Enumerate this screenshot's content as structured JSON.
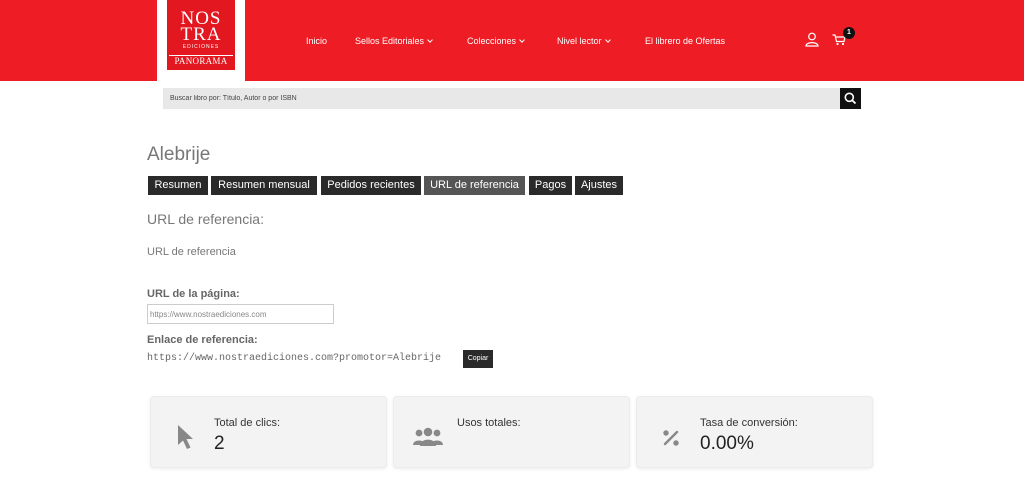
{
  "brand": {
    "line1": "NOS",
    "line2": "TRA",
    "line3": "EDICIONES",
    "line4": "PANORAMA",
    "color": "#ee1c25"
  },
  "nav": {
    "items": [
      {
        "label": "Inicio",
        "has_dropdown": false
      },
      {
        "label": "Sellos Editoriales",
        "has_dropdown": true
      },
      {
        "label": "Colecciones",
        "has_dropdown": true
      },
      {
        "label": "Nivel lector",
        "has_dropdown": true
      },
      {
        "label": "El librero de Ofertas",
        "has_dropdown": false
      }
    ],
    "user_icon": "user-icon",
    "cart_icon": "cart-icon",
    "cart_count": "1"
  },
  "search": {
    "placeholder": "Buscar libro por: Título, Autor o por ISBN",
    "icon": "search-icon"
  },
  "page": {
    "title": "Alebrije"
  },
  "tabs": [
    {
      "label": "Resumen",
      "active": false
    },
    {
      "label": "Resumen mensual",
      "active": false
    },
    {
      "label": "Pedidos recientes",
      "active": false
    },
    {
      "label": "URL de referencia",
      "active": true
    },
    {
      "label": "Pagos",
      "active": false
    },
    {
      "label": "Ajustes",
      "active": false
    }
  ],
  "referral": {
    "section_title": "URL de referencia:",
    "section_subtitle": "URL de referencia",
    "page_url_label": "URL de la página:",
    "page_url_value": "https://www.nostraediciones.com",
    "link_label": "Enlace de referencia:",
    "link_value": "https://www.nostraediciones.com?promotor=Alebrije",
    "copy_label": "Copiar"
  },
  "stats": [
    {
      "label": "Total de clics:",
      "value": "2",
      "icon": "cursor-icon"
    },
    {
      "label": "Usos totales:",
      "value": "",
      "icon": "users-icon"
    },
    {
      "label": "Tasa de conversión:",
      "value": "0.00%",
      "icon": "percent-icon"
    }
  ]
}
